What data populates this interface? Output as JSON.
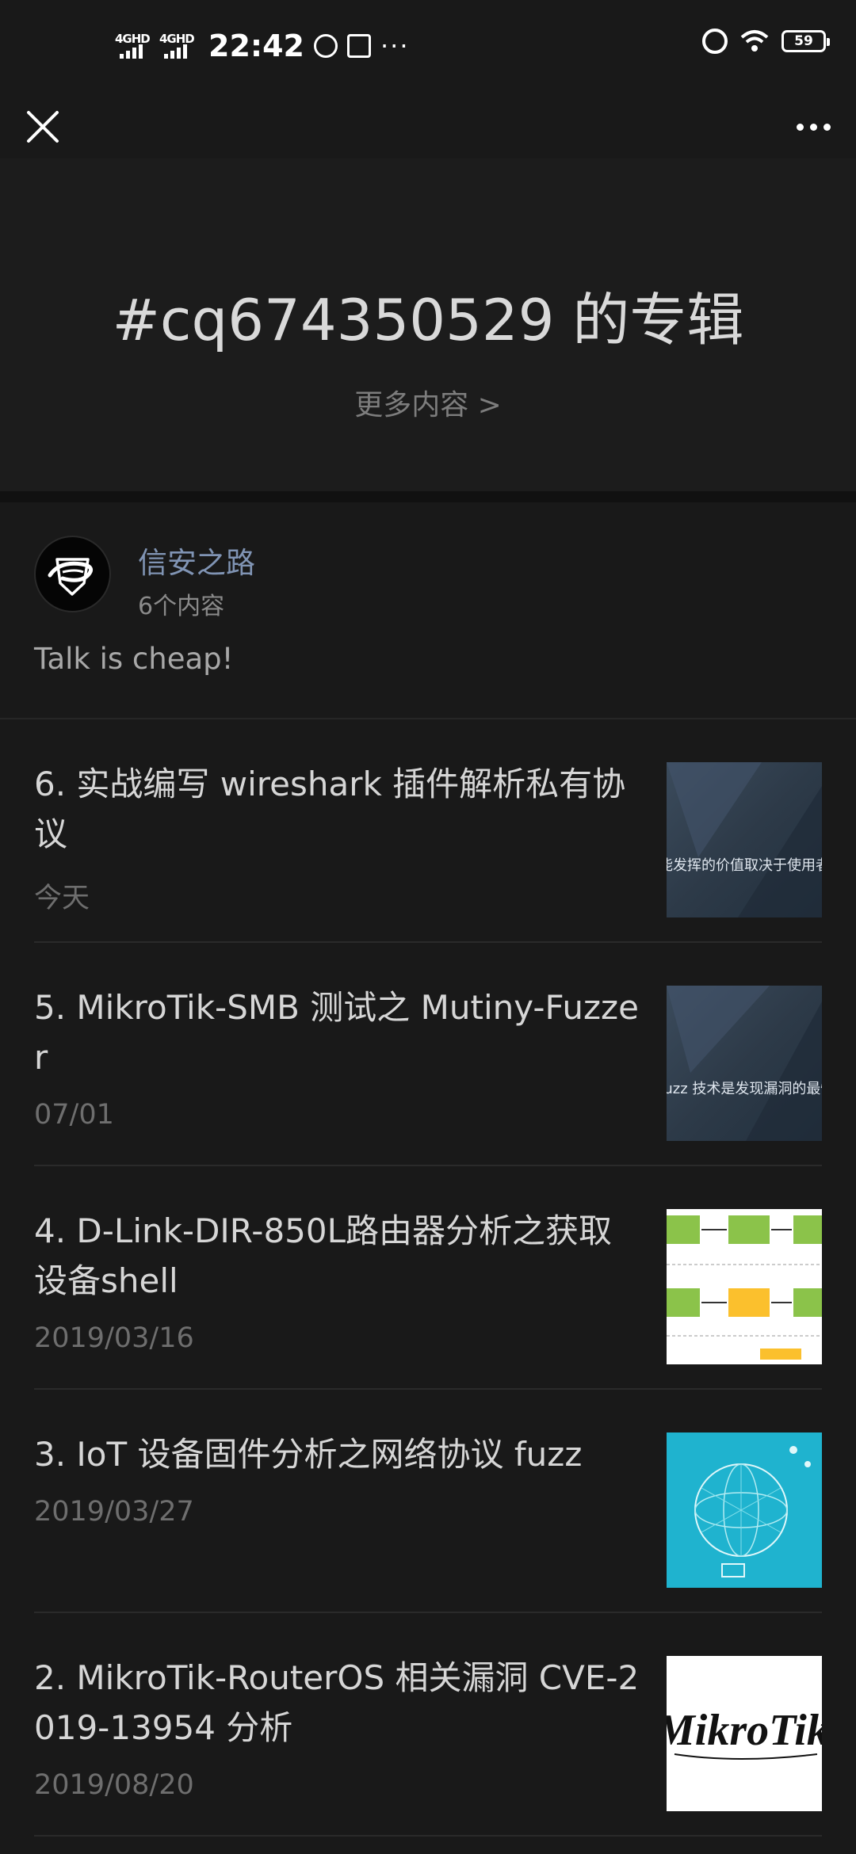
{
  "status_bar": {
    "network_1": "4GHD",
    "network_2": "4GHD",
    "time": "22:42",
    "more": "···",
    "battery": "59"
  },
  "album": {
    "title": "#cq674350529 的专辑",
    "more_link": "更多内容 >"
  },
  "author": {
    "name": "信安之路",
    "count": "6个内容",
    "description": "Talk is cheap!"
  },
  "articles": [
    {
      "title": "6. 实战编写 wireshark 插件解析私有协议",
      "date": "今天",
      "thumb_caption": "能发挥的价值取决于使用者的"
    },
    {
      "title": "5. MikroTik-SMB 测试之 Mutiny-Fuzzer",
      "date": "07/01",
      "thumb_caption": "fuzz 技术是发现漏洞的最快方式"
    },
    {
      "title": "4. D-Link-DIR-850L路由器分析之获取设备shell",
      "date": "2019/03/16"
    },
    {
      "title": "3. IoT 设备固件分析之网络协议 fuzz",
      "date": "2019/03/27"
    },
    {
      "title": "2. MikroTik-RouterOS 相关漏洞 CVE-2019-13954 分析",
      "date": "2019/08/20",
      "thumb_logo": "MikroTik"
    }
  ],
  "icons": {
    "close": "close-icon",
    "more": "more-icon",
    "alarm": "alarm-icon",
    "wifi": "wifi-icon"
  }
}
